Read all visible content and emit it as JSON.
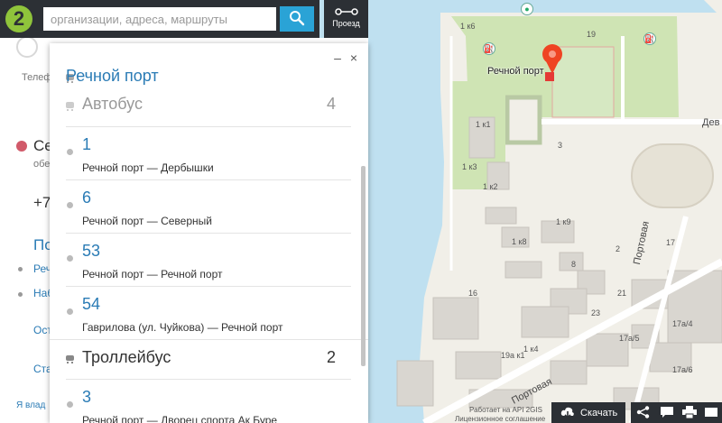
{
  "search": {
    "placeholder": "организации, адреса, маршруты"
  },
  "route_button": {
    "label": "Проезд"
  },
  "logo": {
    "glyph": "2"
  },
  "left_panel": {
    "phone_label": "Телеф",
    "schedule_title": "Се",
    "schedule_sub": "обе",
    "phone_value": "+7",
    "section_title": "По",
    "link1": "Реч",
    "link2": "Наб",
    "link3": "Ост",
    "link4": "Ста",
    "footer": "Я влад"
  },
  "popup": {
    "minimize": "–",
    "close": "×",
    "stop_title": "Речной порт",
    "groups": [
      {
        "type": "Автобус",
        "count": "4",
        "routes": [
          {
            "number": "1",
            "direction": "Речной порт — Дербышки"
          },
          {
            "number": "6",
            "direction": "Речной порт — Северный"
          },
          {
            "number": "53",
            "direction": "Речной порт — Речной порт"
          },
          {
            "number": "54",
            "direction": "Гаврилова (ул. Чуйкова) — Речной порт"
          }
        ]
      },
      {
        "type": "Троллейбус",
        "count": "2",
        "routes": [
          {
            "number": "3",
            "direction": "Речной порт — Дворец спорта Ак Буре"
          }
        ]
      }
    ]
  },
  "map": {
    "poi_label": "Речной порт",
    "streets": {
      "dev": "Дев",
      "portovaya_1": "Портовая",
      "portovaya_2": "Портовая"
    },
    "buildings": [
      "1 к6",
      "19",
      "1 к1",
      "3",
      "1 к3",
      "1 к2",
      "1 к9",
      "1 к8",
      "2",
      "17",
      "8",
      "21",
      "16",
      "23",
      "17а/4",
      "17а/5",
      "17а/6",
      "19а к1",
      "1 к4"
    ],
    "credit_line1": "Работает на API 2GIS",
    "credit_line2": "Лицензионное соглашение"
  },
  "bottom_bar": {
    "download_label": "Скачать"
  },
  "colors": {
    "accent": "#2aa3d6",
    "link": "#2a7bb5",
    "dark": "#2c3035",
    "brand_green": "#8fc43b",
    "marker": "#ef4423"
  }
}
